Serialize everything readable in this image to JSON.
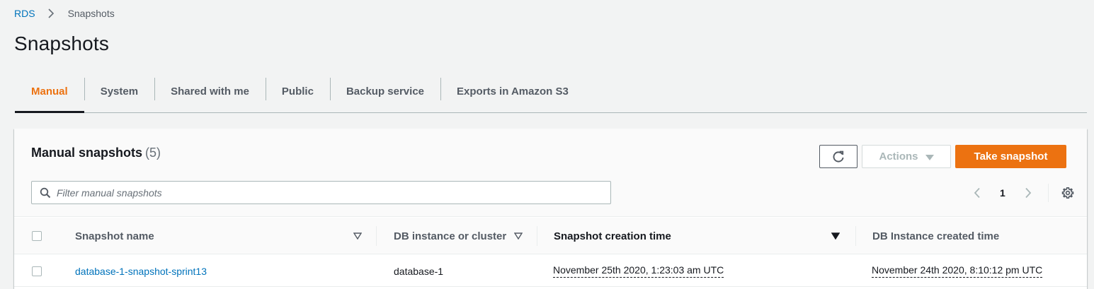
{
  "breadcrumb": {
    "root": "RDS",
    "current": "Snapshots"
  },
  "page": {
    "title": "Snapshots"
  },
  "tabs": [
    {
      "label": "Manual",
      "active": true
    },
    {
      "label": "System",
      "active": false
    },
    {
      "label": "Shared with me",
      "active": false
    },
    {
      "label": "Public",
      "active": false
    },
    {
      "label": "Backup service",
      "active": false
    },
    {
      "label": "Exports in Amazon S3",
      "active": false
    }
  ],
  "panel": {
    "title": "Manual snapshots",
    "count": "(5)",
    "actions_label": "Actions",
    "take_snapshot_label": "Take snapshot",
    "filter_placeholder": "Filter manual snapshots",
    "filter_value": "",
    "current_page": "1"
  },
  "table": {
    "columns": [
      "Snapshot name",
      "DB instance or cluster",
      "Snapshot creation time",
      "DB Instance created time"
    ],
    "sorted_column": "Snapshot creation time",
    "sort_direction": "descending",
    "rows": [
      {
        "snapshot_name": "database-1-snapshot-sprint13",
        "db_instance": "database-1",
        "snapshot_creation_time": "November 25th 2020, 1:23:03 am UTC",
        "db_instance_created_time": "November 24th 2020, 8:10:12 pm UTC"
      }
    ]
  },
  "colors": {
    "accent": "#ec7211",
    "link": "#0073bb",
    "text": "#16191f",
    "muted": "#545b64",
    "background": "#f2f3f3"
  },
  "icons": {
    "refresh": "refresh-icon",
    "search": "search-icon",
    "prev": "chevron-left-icon",
    "next": "chevron-right-icon",
    "settings": "gear-icon",
    "breadcrumb_separator": "chevron-right-icon"
  }
}
